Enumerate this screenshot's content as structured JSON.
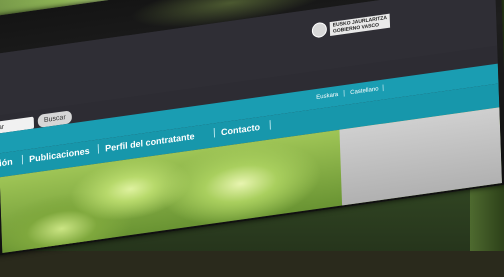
{
  "site": {
    "logo": {
      "line1": "EUSKO JAURLARITZA",
      "line2": "GOBIERNO VASCO"
    },
    "search": {
      "value": "scar",
      "button_label": "Buscar"
    },
    "languages": {
      "euskara": "Euskara",
      "castellano": "Castellano",
      "separator": "|"
    },
    "nav": {
      "items": [
        "ión",
        "Publicaciones",
        "Perfil del contratante",
        "Contacto"
      ],
      "separator": "|"
    }
  },
  "colors": {
    "teal_bar": "#1a9db2",
    "header_dark": "#2f2e35"
  }
}
